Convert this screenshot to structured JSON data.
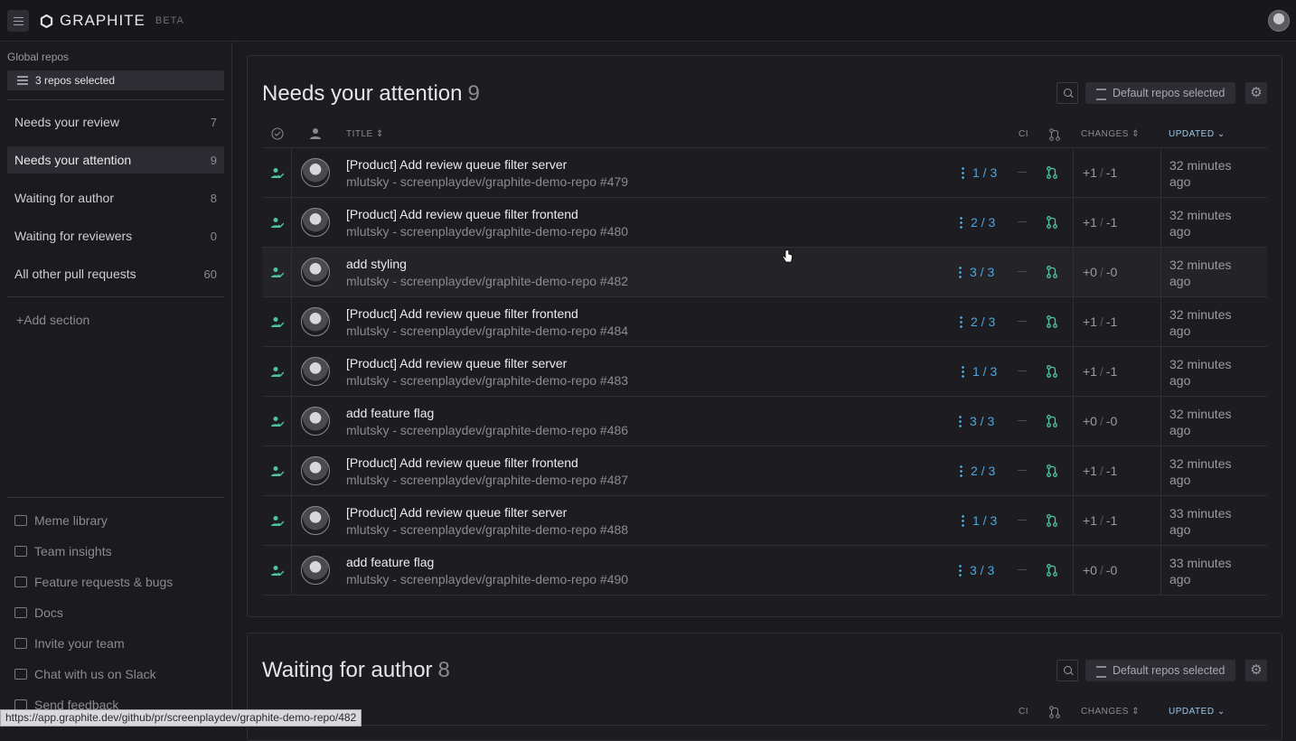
{
  "app": {
    "name": "GRAPHITE",
    "badge": "BETA"
  },
  "sidebar": {
    "global_repos_label": "Global repos",
    "repo_selector": "3 repos selected",
    "sections": [
      {
        "label": "Needs your review",
        "count": "7",
        "active": false
      },
      {
        "label": "Needs your attention",
        "count": "9",
        "active": true
      },
      {
        "label": "Waiting for author",
        "count": "8",
        "active": false
      },
      {
        "label": "Waiting for reviewers",
        "count": "0",
        "active": false
      },
      {
        "label": "All other pull requests",
        "count": "60",
        "active": false
      }
    ],
    "add_section": "Add section",
    "footer": [
      {
        "label": "Meme library",
        "icon": "chat-icon"
      },
      {
        "label": "Team insights",
        "icon": "chart-icon"
      },
      {
        "label": "Feature requests & bugs",
        "icon": "inbox-icon"
      },
      {
        "label": "Docs",
        "icon": "layers-icon"
      },
      {
        "label": "Invite your team",
        "icon": "invite-icon"
      },
      {
        "label": "Chat with us on Slack",
        "icon": "message-icon"
      },
      {
        "label": "Send feedback",
        "icon": "edit-icon"
      }
    ]
  },
  "panels": [
    {
      "title": "Needs your attention",
      "count": "9",
      "repos_button": "Default repos selected",
      "columns": {
        "title": "TITLE",
        "ci": "CI",
        "changes": "CHANGES",
        "updated": "UPDATED"
      },
      "rows": [
        {
          "title": "[Product] Add review queue filter server",
          "sub": "mlutsky - screenplaydev/graphite-demo-repo #479",
          "reviews": "1 / 3",
          "changes_add": "+1",
          "changes_del": "-1",
          "updated": "32 minutes ago"
        },
        {
          "title": "[Product] Add review queue filter frontend",
          "sub": "mlutsky - screenplaydev/graphite-demo-repo #480",
          "reviews": "2 / 3",
          "changes_add": "+1",
          "changes_del": "-1",
          "updated": "32 minutes ago"
        },
        {
          "title": "add styling",
          "sub": "mlutsky - screenplaydev/graphite-demo-repo #482",
          "reviews": "3 / 3",
          "changes_add": "+0",
          "changes_del": "-0",
          "updated": "32 minutes ago"
        },
        {
          "title": "[Product] Add review queue filter frontend",
          "sub": "mlutsky - screenplaydev/graphite-demo-repo #484",
          "reviews": "2 / 3",
          "changes_add": "+1",
          "changes_del": "-1",
          "updated": "32 minutes ago"
        },
        {
          "title": "[Product] Add review queue filter server",
          "sub": "mlutsky - screenplaydev/graphite-demo-repo #483",
          "reviews": "1 / 3",
          "changes_add": "+1",
          "changes_del": "-1",
          "updated": "32 minutes ago"
        },
        {
          "title": "add feature flag",
          "sub": "mlutsky - screenplaydev/graphite-demo-repo #486",
          "reviews": "3 / 3",
          "changes_add": "+0",
          "changes_del": "-0",
          "updated": "32 minutes ago"
        },
        {
          "title": "[Product] Add review queue filter frontend",
          "sub": "mlutsky - screenplaydev/graphite-demo-repo #487",
          "reviews": "2 / 3",
          "changes_add": "+1",
          "changes_del": "-1",
          "updated": "32 minutes ago"
        },
        {
          "title": "[Product] Add review queue filter server",
          "sub": "mlutsky - screenplaydev/graphite-demo-repo #488",
          "reviews": "1 / 3",
          "changes_add": "+1",
          "changes_del": "-1",
          "updated": "33 minutes ago"
        },
        {
          "title": "add feature flag",
          "sub": "mlutsky - screenplaydev/graphite-demo-repo #490",
          "reviews": "3 / 3",
          "changes_add": "+0",
          "changes_del": "-0",
          "updated": "33 minutes ago"
        }
      ]
    },
    {
      "title": "Waiting for author",
      "count": "8",
      "repos_button": "Default repos selected",
      "columns": {
        "ci": "CI",
        "changes": "CHANGES",
        "updated": "UPDATED"
      }
    }
  ],
  "statusbar_url": "https://app.graphite.dev/github/pr/screenplaydev/graphite-demo-repo/482",
  "colors": {
    "accent": "#4aa8e0",
    "success": "#4fc59a",
    "background": "#1b1b1e"
  }
}
